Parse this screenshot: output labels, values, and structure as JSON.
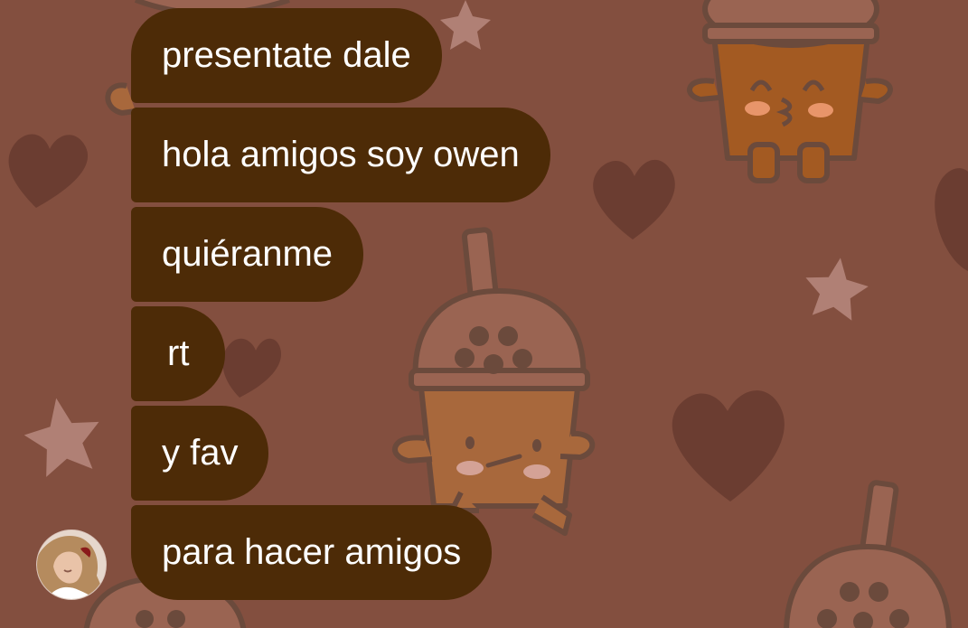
{
  "chat": {
    "messages": [
      {
        "text": "presentate dale"
      },
      {
        "text": "hola amigos soy owen"
      },
      {
        "text": "quiéranme"
      },
      {
        "text": "rt"
      },
      {
        "text": "y fav"
      },
      {
        "text": "para hacer amigos"
      }
    ]
  },
  "sender": {
    "avatar_icon": "profile-photo"
  },
  "theme": {
    "background": "#834f3f",
    "bubble": "#4d2b07",
    "bubble_text": "#ffffff",
    "heart": "#6b3d31",
    "star": "#b08075",
    "boba_cup": "#a8683c"
  }
}
